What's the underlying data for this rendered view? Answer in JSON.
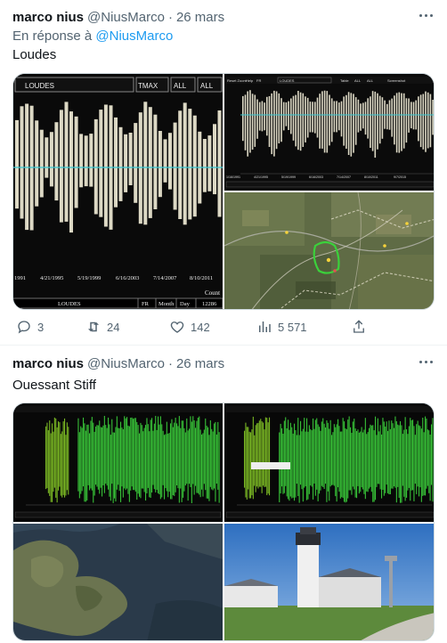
{
  "tweets": [
    {
      "name": "marco nius",
      "handle": "@NiusMarco",
      "separator": "·",
      "date": "26 mars",
      "reply_prefix": "En réponse à",
      "reply_handle": "@NiusMarco",
      "text": "Loudes",
      "images": {
        "chart_large": {
          "station_select": "LOUDES",
          "metric_select": "TMAX",
          "filter_1": "ALL",
          "filter_2": "ALL",
          "x_ticks": [
            "1991",
            "4/21/1995",
            "5/19/1999",
            "6/16/2003",
            "7/14/2007",
            "8/10/2011"
          ],
          "count_label": "Count",
          "footer_station": "LOUDES",
          "footer_country": "FR",
          "footer_period": "Month",
          "footer_day": "Day",
          "footer_count": "12286"
        },
        "chart_small": {
          "toolbar_1": "Reset Zoom",
          "toolbar_2": "Help",
          "toolbar_3": "FR",
          "station_select": "LOUDES",
          "filter_1": "Table",
          "filter_2": "ALL",
          "filter_3": "ALL",
          "screenshot": "Screenshot",
          "x_ticks": [
            "1/16/1991",
            "4/21/1995",
            "5/19/1999",
            "6/16/2003",
            "7/14/2007",
            "8/10/2011",
            "9/7/2015"
          ]
        },
        "map": {}
      },
      "stats": {
        "replies": "3",
        "reposts": "24",
        "likes": "142",
        "views": "5 571"
      }
    },
    {
      "name": "marco nius",
      "handle": "@NiusMarco",
      "separator": "·",
      "date": "26 mars",
      "text": "Ouessant Stiff",
      "images": {
        "chart_a": {},
        "chart_b": {},
        "satellite": {},
        "lighthouse": {}
      }
    }
  ],
  "colors": {
    "text_primary": "#0f1419",
    "text_secondary": "#536471",
    "link": "#1d9bf0",
    "chart_bg": "#0a0a0a",
    "chart_bars_cream": "#dcd8c4",
    "chart_bars_green": "#3fe03f",
    "chart_mean_line": "#39c8d2"
  },
  "icons": [
    "more-icon",
    "reply-icon",
    "repost-icon",
    "like-icon",
    "views-icon",
    "share-icon"
  ]
}
